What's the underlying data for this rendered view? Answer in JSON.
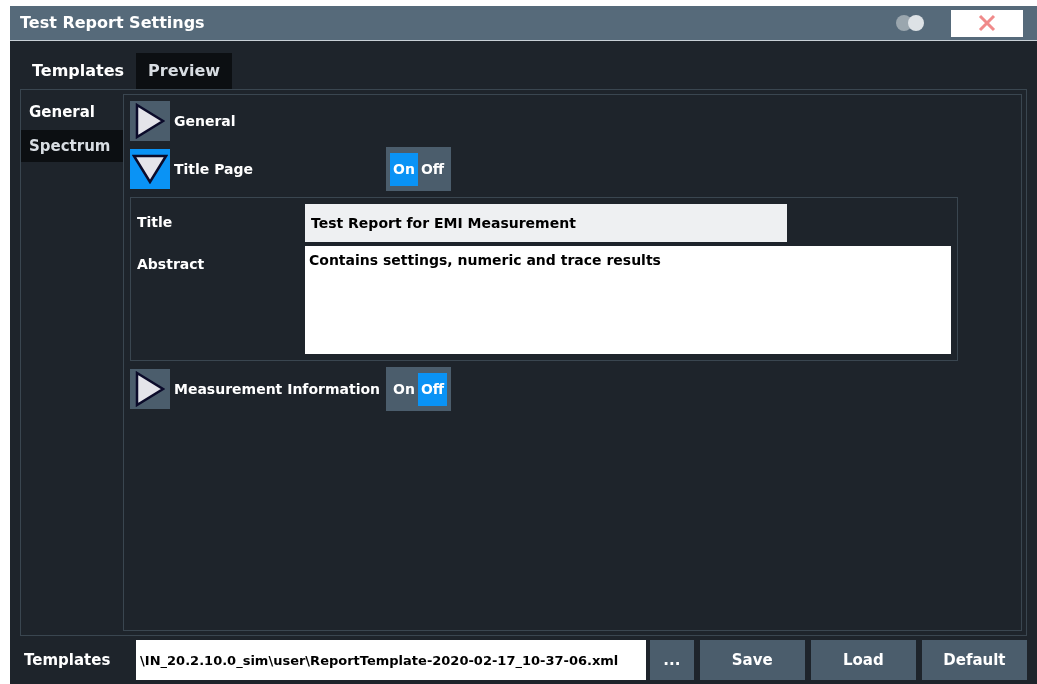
{
  "window": {
    "title": "Test Report Settings"
  },
  "tabs": [
    {
      "label": "Templates",
      "selected": true
    },
    {
      "label": "Preview",
      "selected": false
    }
  ],
  "nav": [
    {
      "label": "General",
      "selected": true
    },
    {
      "label": "Spectrum",
      "selected": false
    }
  ],
  "sections": [
    {
      "label": "General",
      "expanded": false
    },
    {
      "label": "Title Page",
      "expanded": true,
      "toggle": {
        "on_label": "On",
        "off_label": "Off",
        "on": true
      },
      "fields": [
        {
          "label": "Title",
          "value": "Test Report for EMI Measurement",
          "kind": "line"
        },
        {
          "label": "Abstract",
          "value": "Contains settings, numeric and trace results",
          "kind": "area"
        }
      ]
    },
    {
      "label": "Measurement Information",
      "expanded": false,
      "toggle": {
        "on_label": "On",
        "off_label": "Off",
        "on": false
      }
    }
  ],
  "footer": {
    "label": "Templates",
    "path": "\\IN_20.2.10.0_sim\\user\\ReportTemplate-2020-02-17_10-37-06.xml",
    "buttons": [
      "...",
      "Save",
      "Load",
      "Default"
    ]
  }
}
